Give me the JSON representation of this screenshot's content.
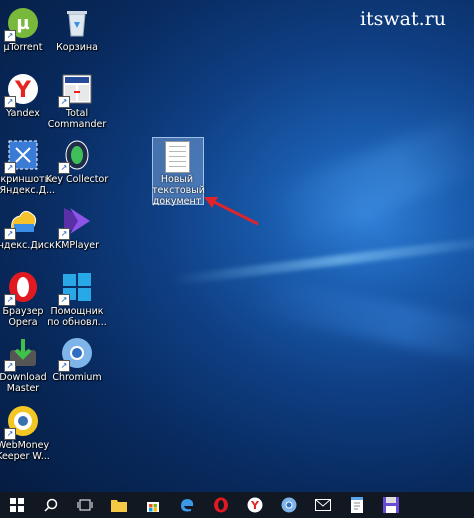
{
  "watermark": "itswat.ru",
  "desktop": {
    "icons": [
      {
        "label": "µTorrent",
        "icon": "utorrent-icon"
      },
      {
        "label": "Корзина",
        "icon": "recycle-bin-icon"
      },
      {
        "label": "Yandex",
        "icon": "yandex-browser-icon"
      },
      {
        "label": "Total Commander",
        "icon": "total-commander-icon"
      },
      {
        "label": "Скриншоты в Яндекс.Д...",
        "icon": "yandex-screenshots-icon"
      },
      {
        "label": "Key Collector",
        "icon": "key-collector-icon"
      },
      {
        "label": "Яндекс.Диск",
        "icon": "yandex-disk-icon"
      },
      {
        "label": "KMPlayer",
        "icon": "kmplayer-icon"
      },
      {
        "label": "Браузер Opera",
        "icon": "opera-icon"
      },
      {
        "label": "Помощник по обновл...",
        "icon": "windows-update-assistant-icon"
      },
      {
        "label": "Download Master",
        "icon": "download-master-icon"
      },
      {
        "label": "Chromium",
        "icon": "chromium-icon"
      },
      {
        "label": "WebMoney Keeper W...",
        "icon": "webmoney-icon"
      }
    ],
    "selected_file": {
      "label": "Новый текстовый документ",
      "icon": "text-document-icon"
    }
  },
  "taskbar": {
    "items": [
      "start-icon",
      "search-icon",
      "task-view-icon",
      "file-explorer-icon",
      "store-icon",
      "edge-icon",
      "opera-icon",
      "yandex-icon",
      "chrome-icon",
      "mail-icon",
      "notepad-icon",
      "save-icon"
    ]
  }
}
